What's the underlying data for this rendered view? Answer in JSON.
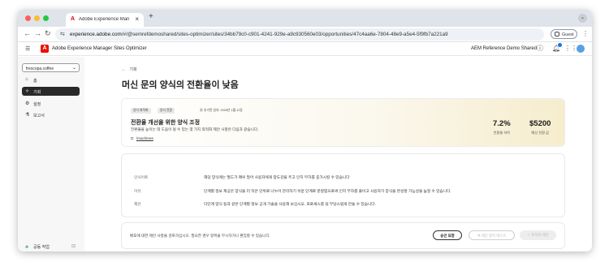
{
  "browser": {
    "tab_title": "Adobe Experience Manager S",
    "tab_close": "×",
    "new_tab": "+",
    "url_prefix": "experience.adobe.com",
    "url_path": "/#/@semrefdemoshared/sites-optimizer/sites/34bb79c0-c901-4241-929e-a9c930560e03/opportunities/47c4aa6e-7804-48e9-a5e4-5f9fb7a221a9",
    "guest_label": "Guest",
    "traffic_colors": [
      "#ff5f57",
      "#febc2e",
      "#28c840"
    ]
  },
  "app_header": {
    "title": "Adobe Experience Manager Sites Optimizer",
    "org": "AEM Reference Demo Shared",
    "icons": [
      "help-icon",
      "bell-icon",
      "apps-grid-icon",
      "avatar"
    ]
  },
  "sidebar": {
    "site_select": "frescopa.coffee",
    "items": [
      {
        "icon": "home-icon",
        "label": "홈",
        "active": false
      },
      {
        "icon": "opportunities-icon",
        "label": "기회",
        "active": true
      },
      {
        "icon": "settings-icon",
        "label": "설정",
        "active": false
      },
      {
        "icon": "reports-icon",
        "label": "보고서",
        "active": false
      }
    ],
    "collab_label": "공동 작업"
  },
  "main": {
    "back_label": "기회",
    "page_title": "머신 문의 양식의 전환율이 낮음",
    "card": {
      "tags": [
        "양식 최적화",
        "양식 전환"
      ],
      "added_text": "추가된 일자: 2025년 1월 11일",
      "title": "전환율 개선을 위한 양식 조정",
      "description": "전환율을 높이는 데 도움이 될 수 있는 몇 가지 최적화 제안 사항은 다음과 같습니다.",
      "link": "/machines",
      "metrics": [
        {
          "value": "7.2%",
          "label": "전환율 하락"
        },
        {
          "value": "$5200",
          "label": "예상 전환 값"
        }
      ]
    },
    "details": [
      {
        "label": "인사이트",
        "value": "해당 양식에는 필드가 매우 많아 사용자에게 압도감을 주고 인지 부하를 증가시킬 수 있습니다"
      },
      {
        "label": "이유",
        "value": "단계별 정보 제공은 양식을 더 작은 단위로 나누어 관리하기 쉬운 단계로 분할함으로써 인지 부하를 줄이고 사용자가 양식을 완성할 가능성을 높일 수 있습니다."
      },
      {
        "label": "제안",
        "value": "다단계 양식 등과 같은 단계별 정보 공개 기술을 사용해 보십시오. 프로세스를 덜 부담스럽게 만들 수 있습니다."
      }
    ],
    "footer": {
      "text": "배포에 대한 제안 사항을 검토하십시오. 필요한 경우 항목을 무시하거나 편집할 수 있습니다.",
      "approve": "승인 요청",
      "test": "제안 항목 테스트",
      "optimize": "최적화 제안"
    }
  }
}
